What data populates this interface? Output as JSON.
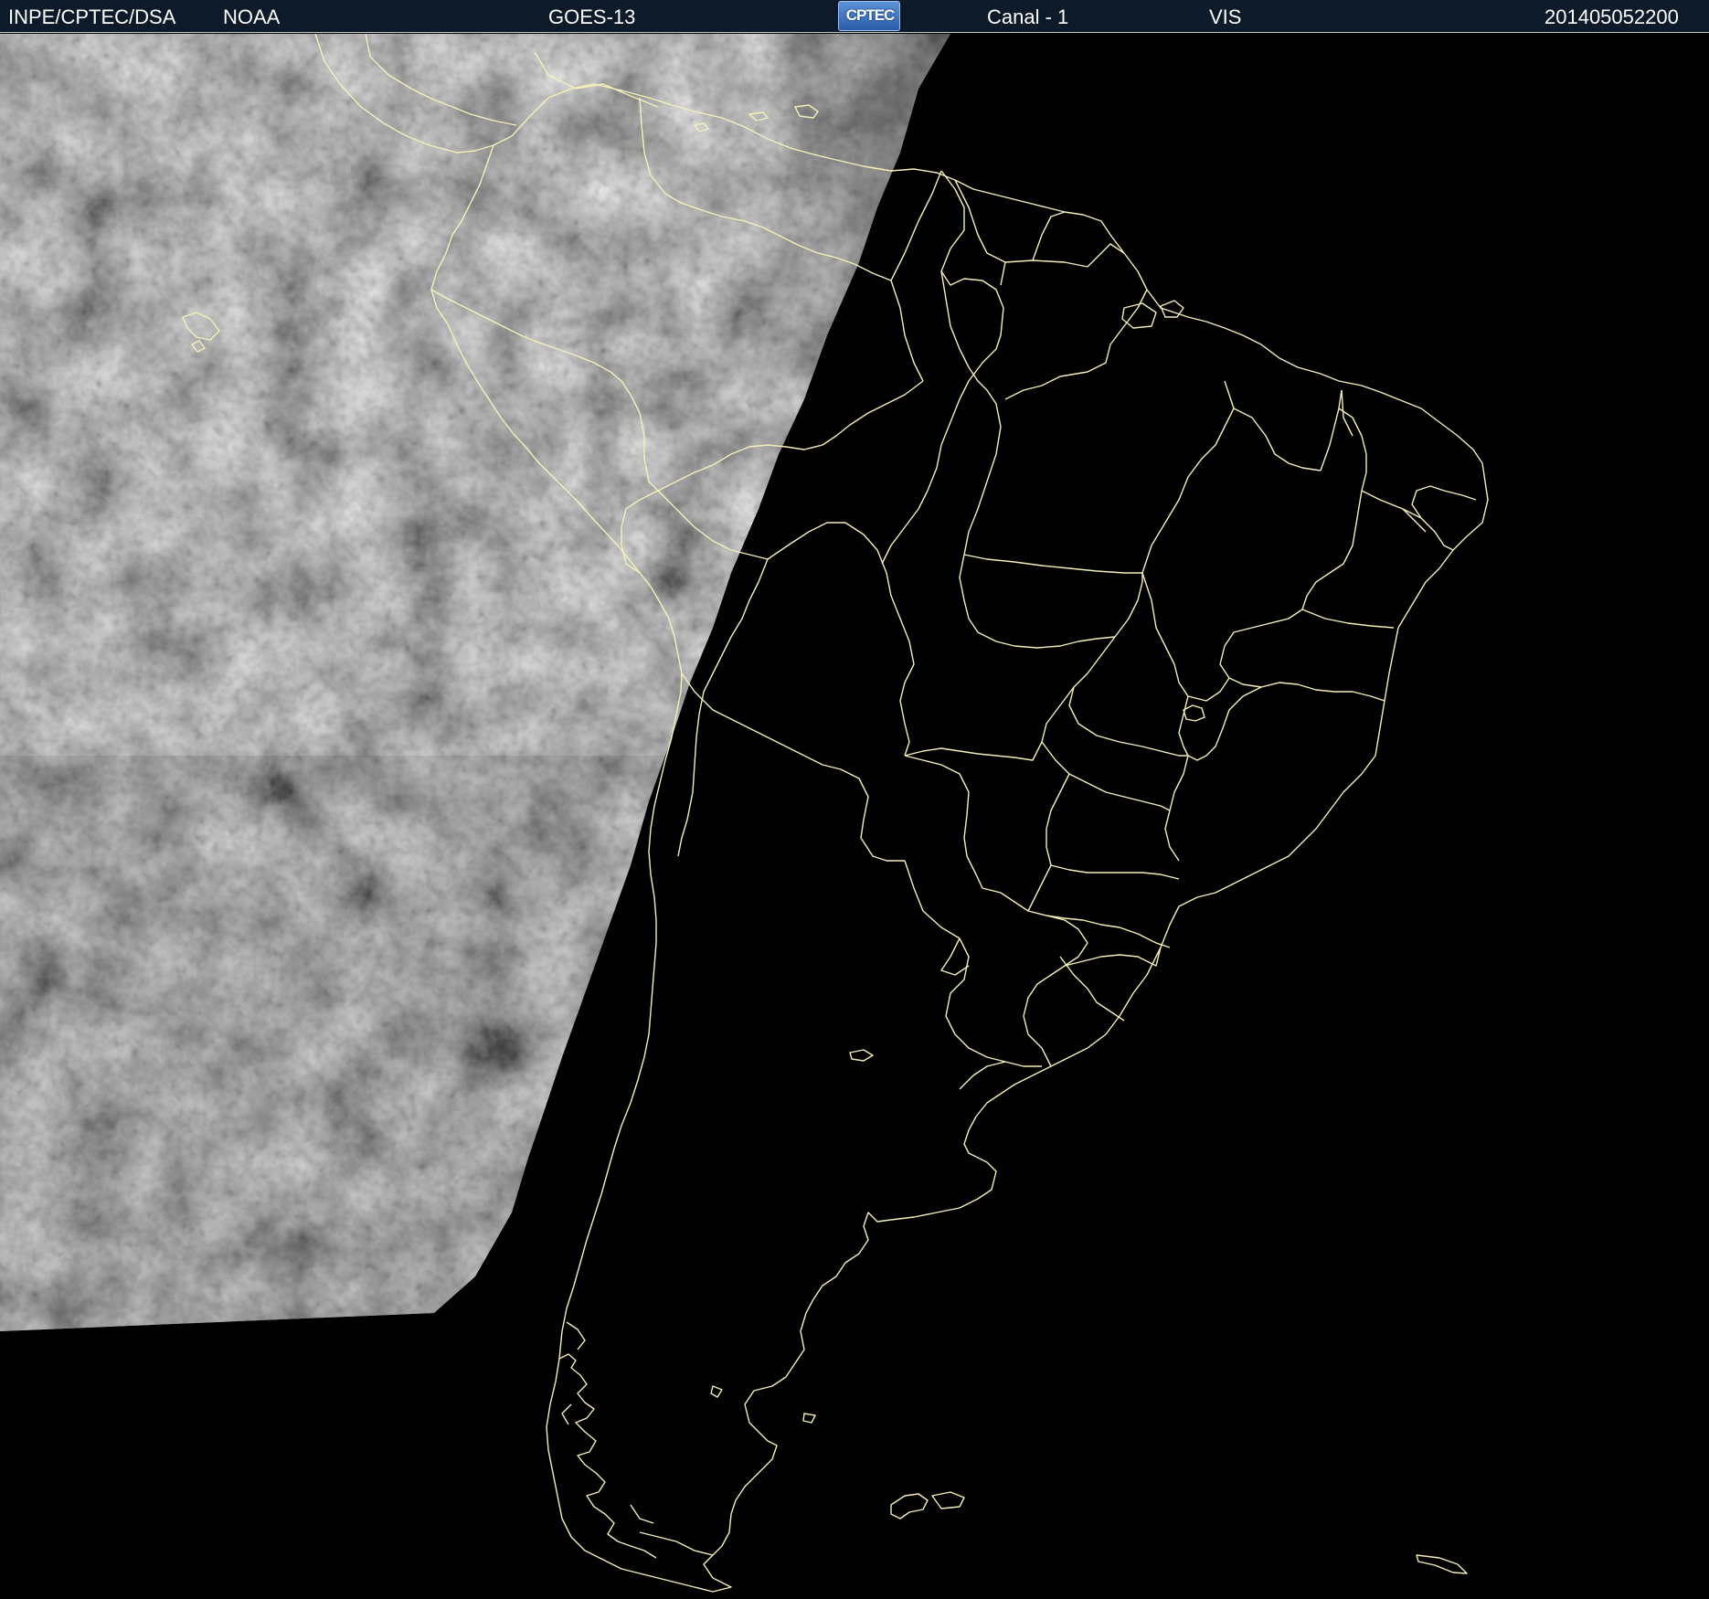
{
  "header": {
    "agency": "INPE/CPTEC/DSA",
    "source": "NOAA",
    "satellite": "GOES-13",
    "logo_text": "CPTEC",
    "channel": "Canal - 1",
    "band": "VIS",
    "timestamp": "201405052200"
  },
  "map": {
    "boundary_color": "#f4f0b8",
    "night_color": "#000000",
    "cloud_light": "#dcdcdc",
    "cloud_dark": "#1c1c1c",
    "logo_color": "#3f74c4"
  }
}
